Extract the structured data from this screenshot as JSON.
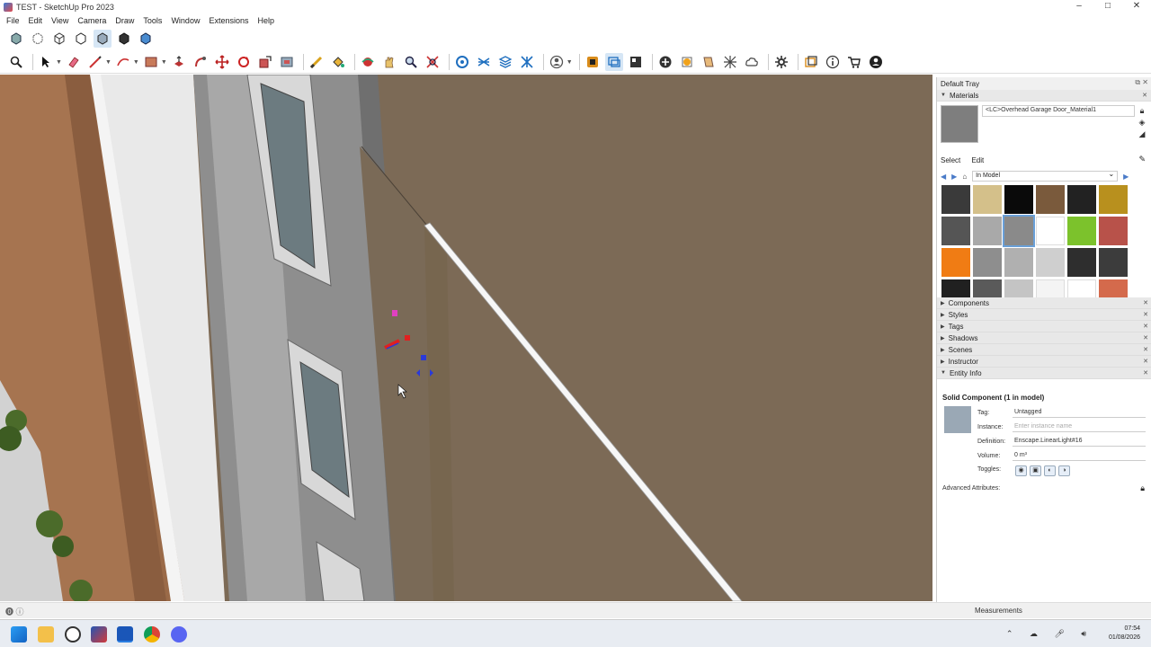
{
  "window": {
    "title": "TEST - SketchUp Pro 2023",
    "controls": [
      "–",
      "□",
      "✕"
    ]
  },
  "menu": [
    "File",
    "Edit",
    "View",
    "Camera",
    "Draw",
    "Tools",
    "Window",
    "Extensions",
    "Help"
  ],
  "tray": {
    "title": "Default Tray",
    "materials": {
      "section_label": "Materials",
      "current_name": "<LC>Overhead Garage Door_Material1",
      "tab_select": "Select",
      "tab_edit": "Edit",
      "library": "In Model",
      "swatches": [
        "#3a3a3a",
        "#d4c08a",
        "#0a0a0a",
        "#7a5a3c",
        "#222222",
        "#b8901e",
        "#555555",
        "#a9a9a9",
        "#8a8a8a",
        "#ffffff",
        "#7cc22c",
        "#b8524a",
        "#f07c14",
        "#8e8e8e",
        "#b0b0b0",
        "#cfcfcf",
        "#2e2e2e",
        "#3c3c3c",
        "#202020",
        "#5a5a5a",
        "#c4c4c4",
        "#f4f4f4",
        "#ffffff",
        "#d46a4c"
      ]
    },
    "sections": [
      "Components",
      "Styles",
      "Tags",
      "Shadows",
      "Scenes",
      "Instructor"
    ],
    "entity_info": {
      "section_label": "Entity Info",
      "title": "Solid Component (1 in model)",
      "tag_label": "Tag:",
      "tag_value": "Untagged",
      "instance_label": "Instance:",
      "instance_placeholder": "Enter instance name",
      "definition_label": "Definition:",
      "definition_value": "Enscape.LinearLight#16",
      "volume_label": "Volume:",
      "volume_value": "0 m³",
      "toggles_label": "Toggles:",
      "advanced": "Advanced Attributes:"
    }
  },
  "status": {
    "measurements_label": "Measurements"
  },
  "clock": {
    "time": "07:54",
    "date": "01/08/2026"
  }
}
